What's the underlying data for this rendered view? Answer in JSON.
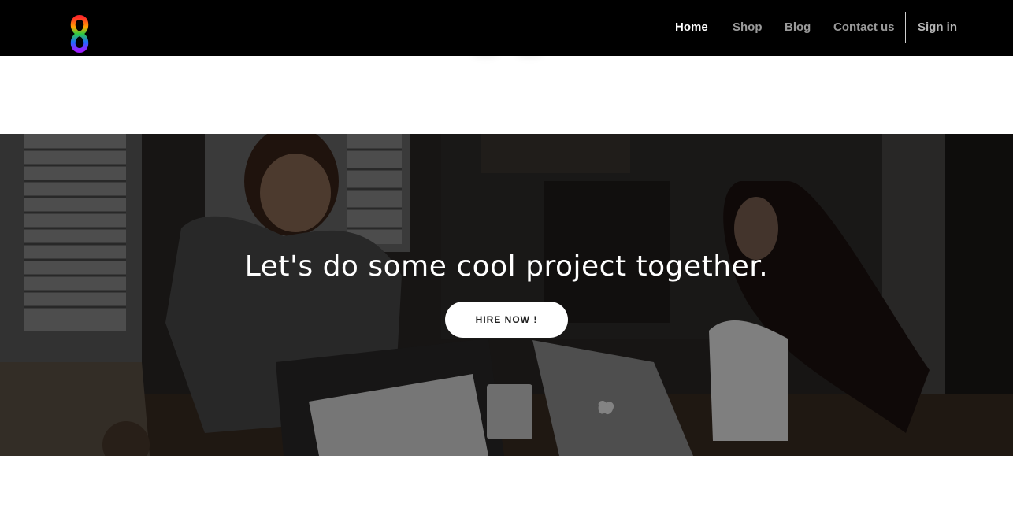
{
  "nav": {
    "logo_icon": "infinity-s-logo",
    "items": [
      {
        "label": "Home",
        "active": true
      },
      {
        "label": "Shop",
        "active": false
      },
      {
        "label": "Blog",
        "active": false
      },
      {
        "label": "Contact us",
        "active": false
      }
    ],
    "signin_label": "Sign in"
  },
  "hero": {
    "title": "Let's do some cool project together.",
    "button_label": "HIRE NOW !",
    "image": "two people working on laptops at a table"
  },
  "colors": {
    "nav_bg": "#000000",
    "nav_active": "#ffffff",
    "nav_inactive": "#9a9a9a",
    "button_bg": "#ffffff"
  }
}
